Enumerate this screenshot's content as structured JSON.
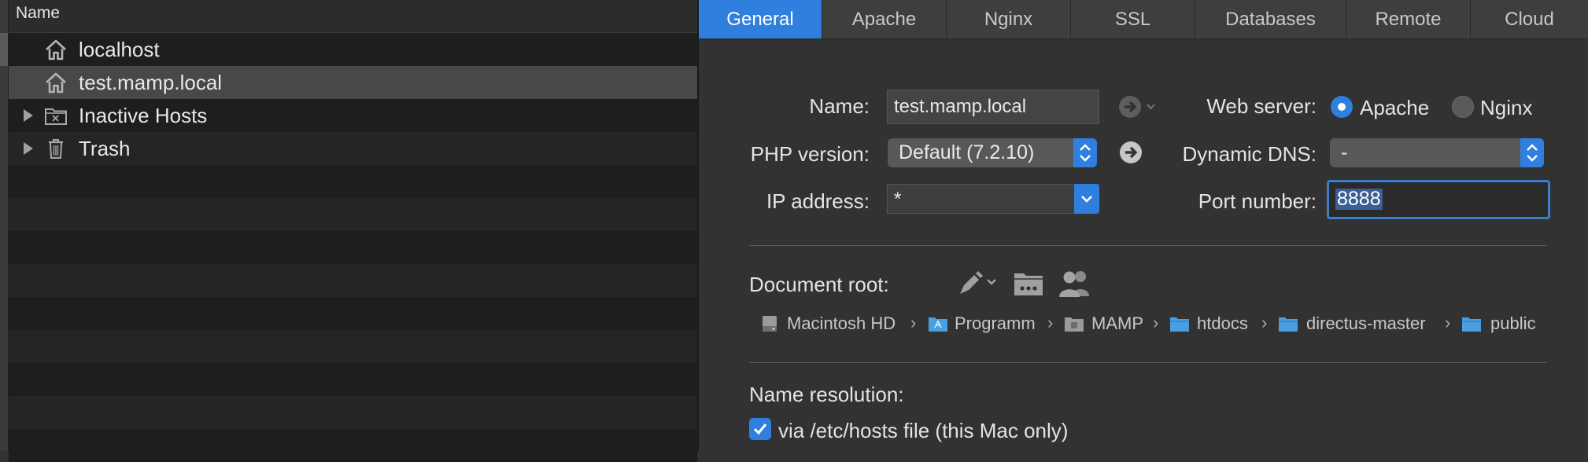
{
  "sidebar": {
    "header": "Name",
    "items": [
      {
        "label": "localhost",
        "icon": "house-icon",
        "expandable": false
      },
      {
        "label": "test.mamp.local",
        "icon": "house-icon",
        "expandable": false,
        "selected": true
      },
      {
        "label": "Inactive Hosts",
        "icon": "inactive-folder-icon",
        "expandable": true
      },
      {
        "label": "Trash",
        "icon": "trash-icon",
        "expandable": true
      }
    ]
  },
  "tabs": [
    "General",
    "Apache",
    "Nginx",
    "SSL",
    "Databases",
    "Remote",
    "Cloud"
  ],
  "active_tab": "General",
  "form": {
    "name_label": "Name:",
    "name_value": "test.mamp.local",
    "php_label": "PHP version:",
    "php_value": "Default (7.2.10)",
    "ip_label": "IP address:",
    "ip_value": "*",
    "webserver_label": "Web server:",
    "webserver_options": [
      "Apache",
      "Nginx"
    ],
    "webserver_selected": "Apache",
    "ddns_label": "Dynamic DNS:",
    "ddns_value": "-",
    "port_label": "Port number:",
    "port_value": "8888",
    "docroot_label": "Document root:",
    "docroot_path": [
      "Macintosh HD",
      "Programm",
      "MAMP",
      "htdocs",
      "directus-master",
      "public"
    ],
    "name_resolution_label": "Name resolution:",
    "hosts_file_checkbox": "via /etc/hosts file (this Mac only)",
    "hosts_file_checked": true
  },
  "colors": {
    "accent": "#2f7fdf",
    "panel": "#323232",
    "sidebar": "#1e1e1e"
  }
}
